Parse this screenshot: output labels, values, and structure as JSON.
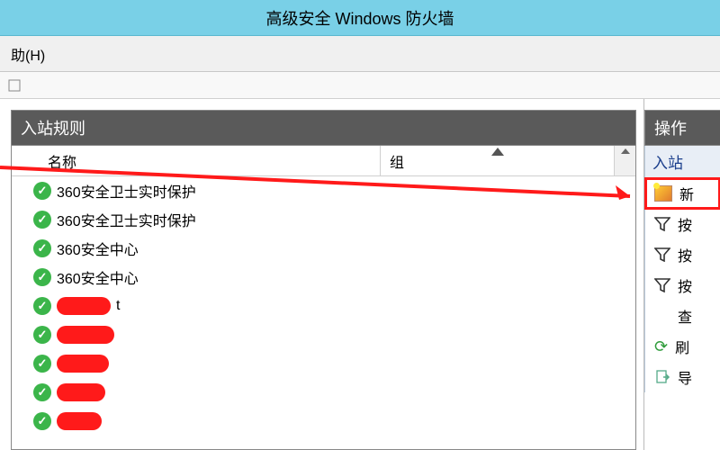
{
  "window": {
    "title": "高级安全 Windows 防火墙"
  },
  "menubar": {
    "help": "助(H)"
  },
  "main": {
    "section_title": "入站规则",
    "columns": {
      "name": "名称",
      "group": "组"
    },
    "rules": [
      {
        "label": "360安全卫士实时保护",
        "redacted": false
      },
      {
        "label": "360安全卫士实时保护",
        "redacted": false
      },
      {
        "label": "360安全中心",
        "redacted": false
      },
      {
        "label": "360安全中心",
        "redacted": false
      },
      {
        "label": "t",
        "redacted": true,
        "redact_width": 60
      },
      {
        "label": "",
        "redacted": true,
        "redact_width": 64
      },
      {
        "label": "",
        "redacted": true,
        "redact_width": 58
      },
      {
        "label": "",
        "redacted": true,
        "redact_width": 54
      },
      {
        "label": "",
        "redacted": true,
        "redact_width": 50
      }
    ]
  },
  "actions": {
    "header": "操作",
    "subheader": "入站",
    "items": [
      {
        "kind": "new",
        "label": "新"
      },
      {
        "kind": "filter",
        "label": "按"
      },
      {
        "kind": "filter",
        "label": "按"
      },
      {
        "kind": "filter",
        "label": "按"
      },
      {
        "kind": "plain",
        "label": "查"
      },
      {
        "kind": "refresh",
        "label": "刷"
      },
      {
        "kind": "export",
        "label": "导"
      }
    ]
  },
  "annotation": {
    "color": "#ff1a1a"
  }
}
